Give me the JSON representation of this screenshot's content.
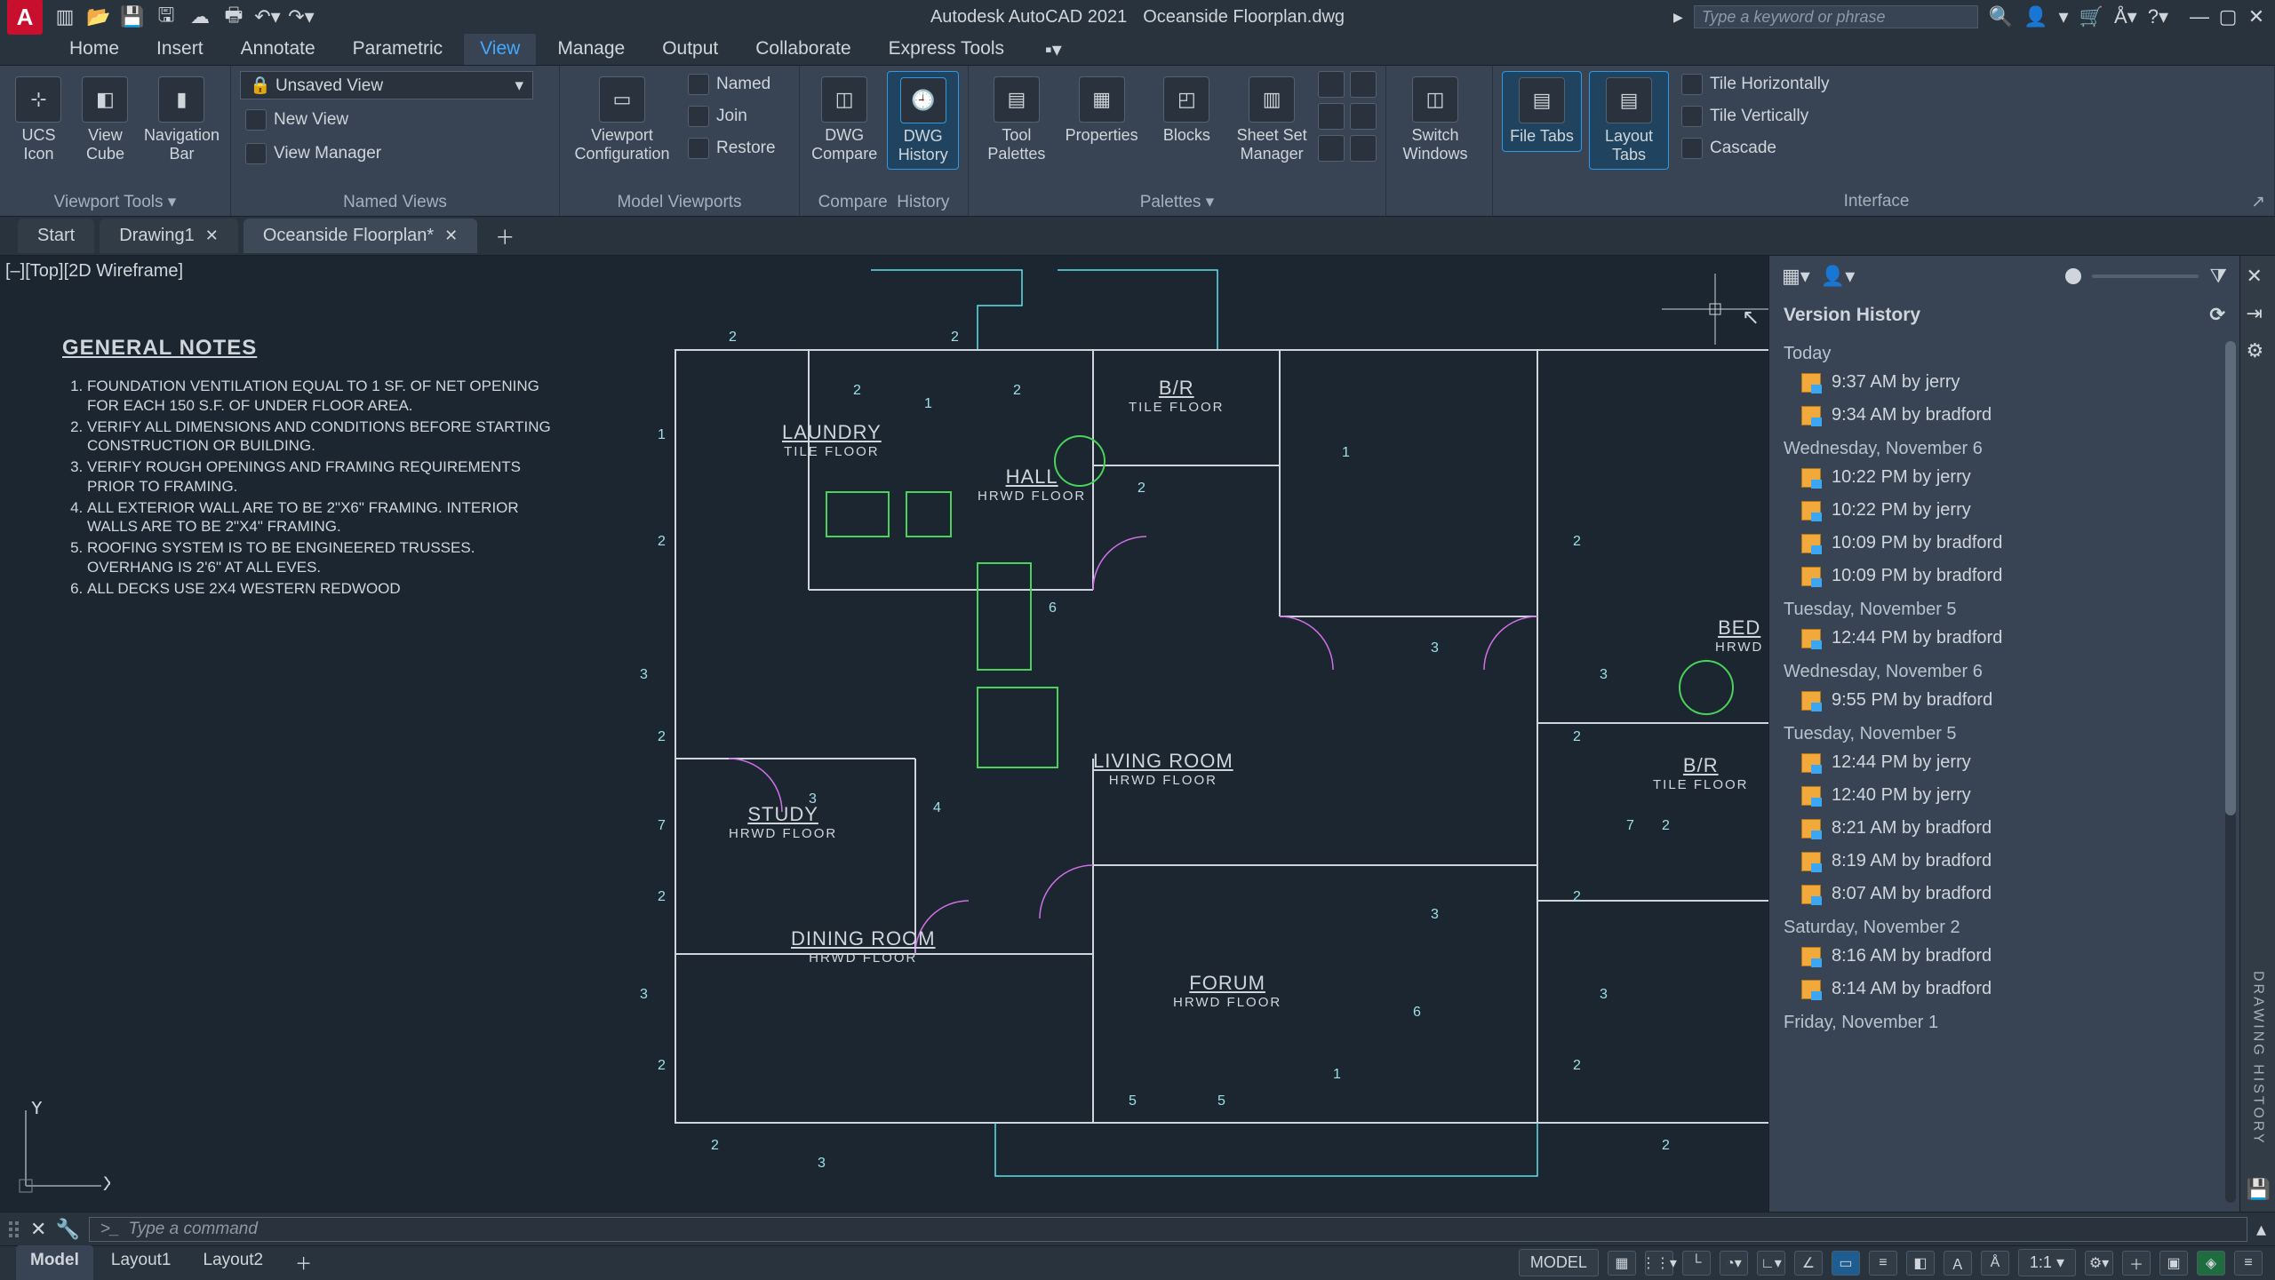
{
  "app": {
    "vendor": "Autodesk AutoCAD 2021",
    "file": "Oceanside Floorplan.dwg"
  },
  "search": {
    "placeholder": "Type a keyword or phrase"
  },
  "ribbon_tabs": [
    "Home",
    "Insert",
    "Annotate",
    "Parametric",
    "View",
    "Manage",
    "Output",
    "Collaborate",
    "Express Tools"
  ],
  "active_ribbon_tab": "View",
  "view_panel": {
    "viewport_tools": {
      "ucs": "UCS Icon",
      "cube": "View Cube",
      "nav": "Navigation Bar",
      "title": "Viewport Tools"
    },
    "named_views": {
      "unsaved": "Unsaved View",
      "new": "New View",
      "mgr": "View Manager",
      "named": "Named",
      "join": "Join",
      "restore": "Restore",
      "title": "Named Views"
    },
    "model_viewports": {
      "config": "Viewport Configuration",
      "title": "Model Viewports"
    },
    "compare": {
      "dwg": "DWG Compare",
      "hist": "DWG History",
      "title1": "Compare",
      "title2": "History"
    },
    "palettes": {
      "tool": "Tool Palettes",
      "props": "Properties",
      "blocks": "Blocks",
      "sheet": "Sheet Set Manager",
      "title": "Palettes"
    },
    "windows": {
      "switch": "Switch Windows",
      "file_tabs": "File Tabs",
      "layout_tabs": "Layout Tabs",
      "tile_h": "Tile Horizontally",
      "tile_v": "Tile Vertically",
      "cascade": "Cascade",
      "title": "Interface"
    }
  },
  "file_tabs": [
    {
      "label": "Start",
      "closable": false
    },
    {
      "label": "Drawing1",
      "closable": true
    },
    {
      "label": "Oceanside Floorplan*",
      "closable": true,
      "active": true
    }
  ],
  "view_label": "[–][Top][2D Wireframe]",
  "notes": {
    "heading": "GENERAL NOTES",
    "items": [
      "FOUNDATION VENTILATION EQUAL TO 1 SF. OF NET OPENING FOR EACH 150 S.F. OF UNDER FLOOR AREA.",
      "VERIFY ALL DIMENSIONS AND CONDITIONS BEFORE STARTING CONSTRUCTION OR BUILDING.",
      "VERIFY ROUGH OPENINGS AND FRAMING REQUIREMENTS PRIOR TO FRAMING.",
      "ALL EXTERIOR WALL ARE TO BE 2\"X6\" FRAMING. INTERIOR WALLS ARE TO BE 2\"X4\" FRAMING.",
      "ROOFING SYSTEM IS TO BE ENGINEERED TRUSSES. OVERHANG IS 2'6\" AT ALL EVES.",
      "ALL DECKS USE 2X4 WESTERN REDWOOD"
    ]
  },
  "rooms": {
    "laundry": {
      "name": "LAUNDRY",
      "floor": "TILE FLOOR"
    },
    "br1": {
      "name": "B/R",
      "floor": "TILE FLOOR"
    },
    "hall": {
      "name": "HALL",
      "floor": "HRWD FLOOR"
    },
    "living": {
      "name": "LIVING ROOM",
      "floor": "HRWD FLOOR"
    },
    "study": {
      "name": "STUDY",
      "floor": "HRWD FLOOR"
    },
    "dining": {
      "name": "DINING ROOM",
      "floor": "HRWD FLOOR"
    },
    "forum": {
      "name": "FORUM",
      "floor": "HRWD FLOOR"
    },
    "bed": {
      "name": "BED",
      "floor": "HRWD"
    },
    "br2": {
      "name": "B/R",
      "floor": "TILE FLOOR"
    }
  },
  "version_history": {
    "title": "Version History",
    "groups": [
      {
        "label": "Today",
        "items": [
          {
            "t": "9:37 AM by jerry"
          },
          {
            "t": "9:34 AM by bradford"
          }
        ]
      },
      {
        "label": "Wednesday, November 6",
        "items": [
          {
            "t": "10:22 PM by jerry"
          },
          {
            "t": "10:22 PM by jerry"
          },
          {
            "t": "10:09 PM by bradford"
          },
          {
            "t": "10:09 PM by bradford"
          }
        ]
      },
      {
        "label": "Tuesday, November 5",
        "items": [
          {
            "t": "12:44 PM by bradford"
          }
        ]
      },
      {
        "label": "Wednesday, November 6",
        "items": [
          {
            "t": "9:55 PM by bradford"
          }
        ]
      },
      {
        "label": "Tuesday, November 5",
        "items": [
          {
            "t": "12:44 PM by jerry"
          },
          {
            "t": "12:40 PM by jerry"
          },
          {
            "t": "8:21 AM by bradford"
          },
          {
            "t": "8:19 AM by bradford"
          },
          {
            "t": "8:07 AM by bradford"
          }
        ]
      },
      {
        "label": "Saturday, November 2",
        "items": [
          {
            "t": "8:16 AM by bradford"
          },
          {
            "t": "8:14 AM by bradford"
          }
        ]
      },
      {
        "label": "Friday, November 1",
        "items": []
      }
    ]
  },
  "side_strip_label": "DRAWING HISTORY",
  "command": {
    "placeholder": "Type a command",
    "prompt": ">_"
  },
  "layout_tabs": [
    "Model",
    "Layout1",
    "Layout2"
  ],
  "status": {
    "model": "MODEL",
    "scale": "1:1"
  }
}
